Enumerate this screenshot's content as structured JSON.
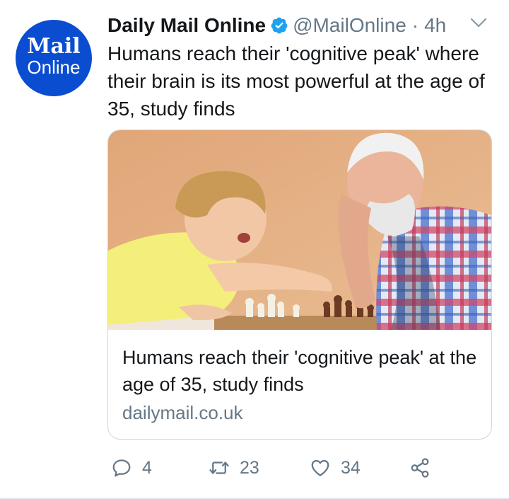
{
  "tweet": {
    "avatar": {
      "line1": "Mail",
      "line2": "Online"
    },
    "author_name": "Daily Mail Online",
    "verified": true,
    "handle": "@MailOnline",
    "separator": "·",
    "time": "4h",
    "text": "Humans reach their 'cognitive peak' where their brain is its most powerful at the age of 35, study finds"
  },
  "card": {
    "title": "Humans reach their 'cognitive peak' at the age of 35, study finds",
    "domain": "dailymail.co.uk"
  },
  "actions": {
    "replies": "4",
    "retweets": "23",
    "likes": "34"
  },
  "icons": {
    "verified": "verified-badge-icon",
    "menu": "chevron-down-icon",
    "reply": "comment-icon",
    "retweet": "retweet-icon",
    "like": "heart-icon",
    "share": "share-icon"
  },
  "colors": {
    "brand_blue": "#0a4dd0",
    "twitter_blue": "#1da1f2",
    "secondary_text": "#657786",
    "border": "#ccd6dd"
  }
}
